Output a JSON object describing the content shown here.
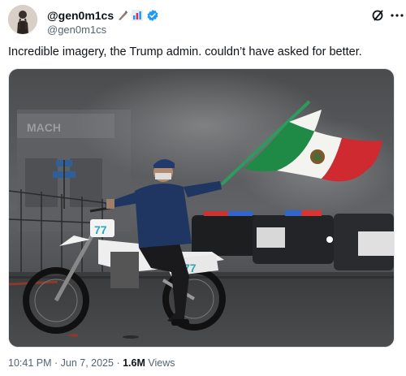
{
  "author": {
    "display_name": "@gen0m1cs",
    "handle": "@gen0m1cs"
  },
  "tweet": {
    "text": "Incredible imagery, the Trump admin. couldn’t have asked for better.",
    "image": {
      "sign_text": "MACH",
      "bike_number": "77"
    }
  },
  "meta": {
    "time": "10:41 PM",
    "separator1": " · ",
    "date": "Jun 7, 2025",
    "separator2": " · ",
    "views_count": "1.6M",
    "views_label": " Views"
  },
  "colors": {
    "verified": "#1d9bf0",
    "flag_green": "#1e8a45",
    "flag_white": "#f3f3f0",
    "flag_red": "#cf2a30",
    "text_secondary": "#536471"
  }
}
